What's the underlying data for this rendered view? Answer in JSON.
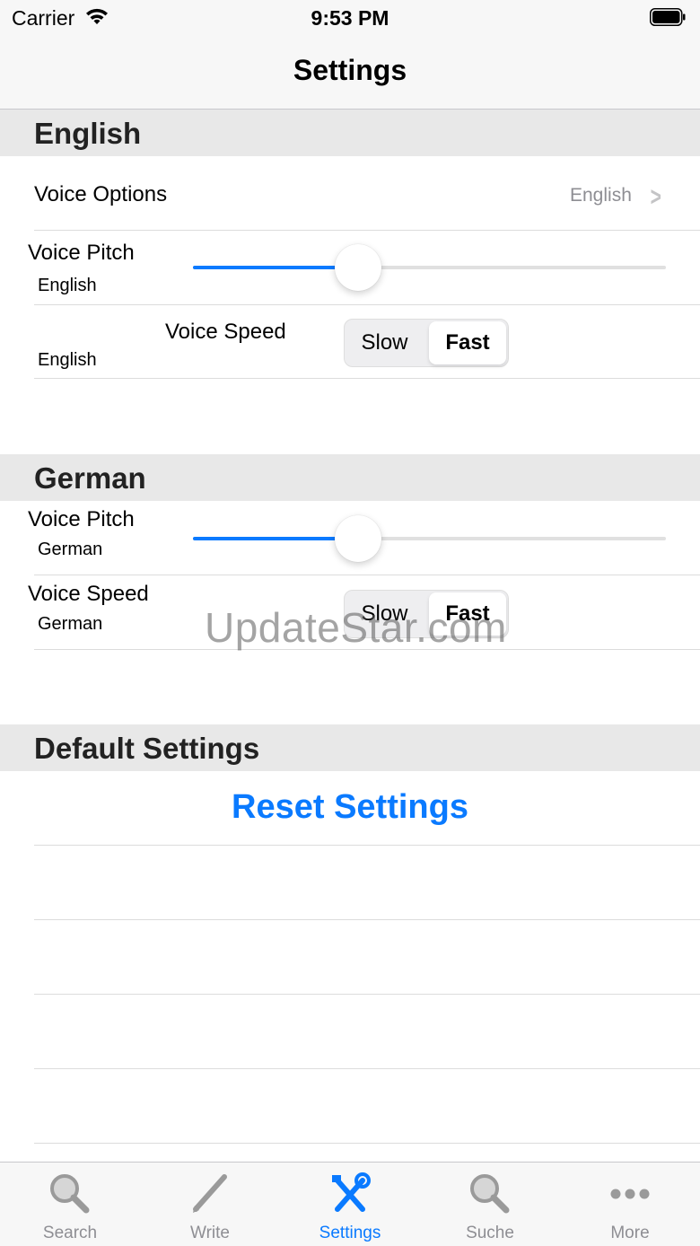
{
  "status_bar": {
    "carrier": "Carrier",
    "time": "9:53 PM"
  },
  "nav": {
    "title": "Settings"
  },
  "sections": {
    "english": {
      "title": "English",
      "voice_options": {
        "label": "Voice Options",
        "value": "English"
      },
      "voice_pitch": {
        "label": "Voice Pitch",
        "sub": "English",
        "value_fraction": 0.35
      },
      "voice_speed": {
        "label": "Voice Speed",
        "sub": "English",
        "options": [
          "Slow",
          "Fast"
        ],
        "selected": "Fast"
      }
    },
    "german": {
      "title": "German",
      "voice_pitch": {
        "label": "Voice Pitch",
        "sub": "German",
        "value_fraction": 0.35
      },
      "voice_speed": {
        "label": "Voice Speed",
        "sub": "German",
        "options": [
          "Slow",
          "Fast"
        ],
        "selected": "Fast"
      }
    },
    "default": {
      "title": "Default Settings",
      "reset_label": "Reset Settings"
    }
  },
  "watermark": "UpdateStar.com",
  "tab_bar": {
    "tabs": [
      {
        "label": "Search",
        "icon": "magnifier-icon",
        "active": false
      },
      {
        "label": "Write",
        "icon": "pencil-icon",
        "active": false
      },
      {
        "label": "Settings",
        "icon": "tools-icon",
        "active": true
      },
      {
        "label": "Suche",
        "icon": "magnifier-icon",
        "active": false
      },
      {
        "label": "More",
        "icon": "more-dots-icon",
        "active": false
      }
    ]
  },
  "colors": {
    "accent": "#0a7aff",
    "secondary_text": "#8e8e93",
    "section_bg": "#e8e8e8"
  }
}
